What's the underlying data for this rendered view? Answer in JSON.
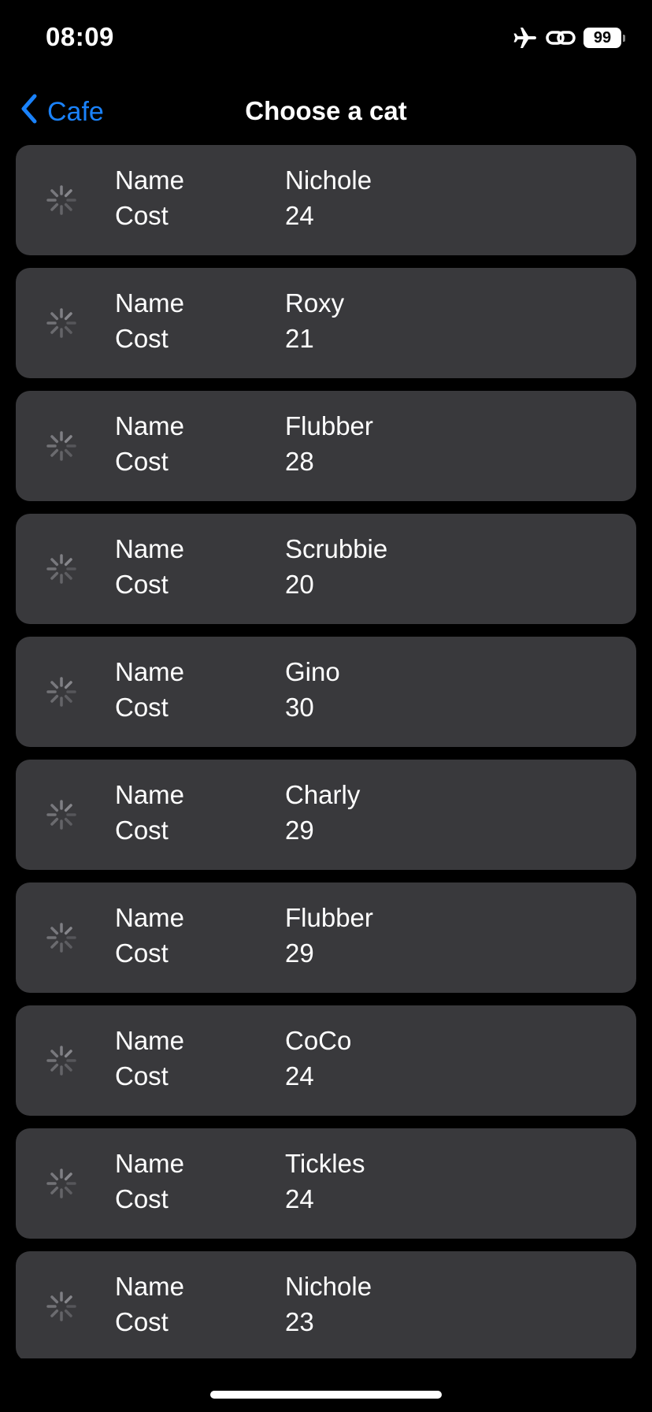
{
  "status_bar": {
    "time": "08:09",
    "battery": "99",
    "icons": [
      "airplane-icon",
      "link-icon",
      "battery-icon"
    ]
  },
  "nav": {
    "back_label": "Cafe",
    "title": "Choose a cat"
  },
  "colors": {
    "accent": "#1a82fb",
    "row_background": "#39393c",
    "background": "#000000"
  },
  "labels": {
    "name": "Name",
    "cost": "Cost"
  },
  "cats": [
    {
      "name": "Nichole",
      "cost": "24"
    },
    {
      "name": "Roxy",
      "cost": "21"
    },
    {
      "name": "Flubber",
      "cost": "28"
    },
    {
      "name": "Scrubbie",
      "cost": "20"
    },
    {
      "name": "Gino",
      "cost": "30"
    },
    {
      "name": "Charly",
      "cost": "29"
    },
    {
      "name": "Flubber",
      "cost": "29"
    },
    {
      "name": "CoCo",
      "cost": "24"
    },
    {
      "name": "Tickles",
      "cost": "24"
    },
    {
      "name": "Nichole",
      "cost": "23"
    }
  ]
}
